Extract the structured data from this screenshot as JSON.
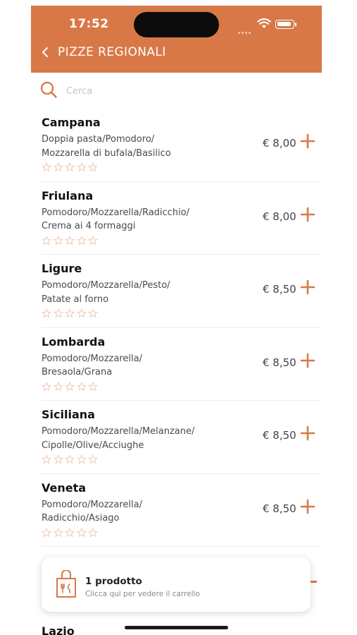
{
  "status": {
    "time": "17:52"
  },
  "header": {
    "title": "PIZZE REGIONALI"
  },
  "search": {
    "placeholder": "Cerca"
  },
  "colors": {
    "accent": "#d97847",
    "star": "#f0c9b4"
  },
  "products": [
    {
      "name": "Campana",
      "desc1": "Doppia pasta/Pomodoro/",
      "desc2": "Mozzarella di bufala/Basilico",
      "price": "€ 8,00",
      "rating": 0
    },
    {
      "name": "Friulana",
      "desc1": "Pomodoro/Mozzarella/Radicchio/",
      "desc2": "Crema ai 4 formaggi",
      "price": "€ 8,00",
      "rating": 0
    },
    {
      "name": "Ligure",
      "desc1": "Pomodoro/Mozzarella/Pesto/",
      "desc2": "Patate al forno",
      "price": "€ 8,50",
      "rating": 0
    },
    {
      "name": "Lombarda",
      "desc1": "Pomodoro/Mozzarella/",
      "desc2": "Bresaola/Grana",
      "price": "€ 8,50",
      "rating": 0
    },
    {
      "name": "Siciliana",
      "desc1": "Pomodoro/Mozzarella/Melanzane/",
      "desc2": "Cipolle/Olive/Acciughe",
      "price": "€ 8,50",
      "rating": 0
    },
    {
      "name": "Veneta",
      "desc1": "Pomodoro/Mozzarella/",
      "desc2": "Radicchio/Asiago",
      "price": "€ 8,50",
      "rating": 0
    }
  ],
  "next_item": {
    "name": "Lazio"
  },
  "cart": {
    "title": "1 prodotto",
    "subtitle": "Clicca qui per vedere il carrello",
    "icon": "shopping-bag-icon"
  }
}
